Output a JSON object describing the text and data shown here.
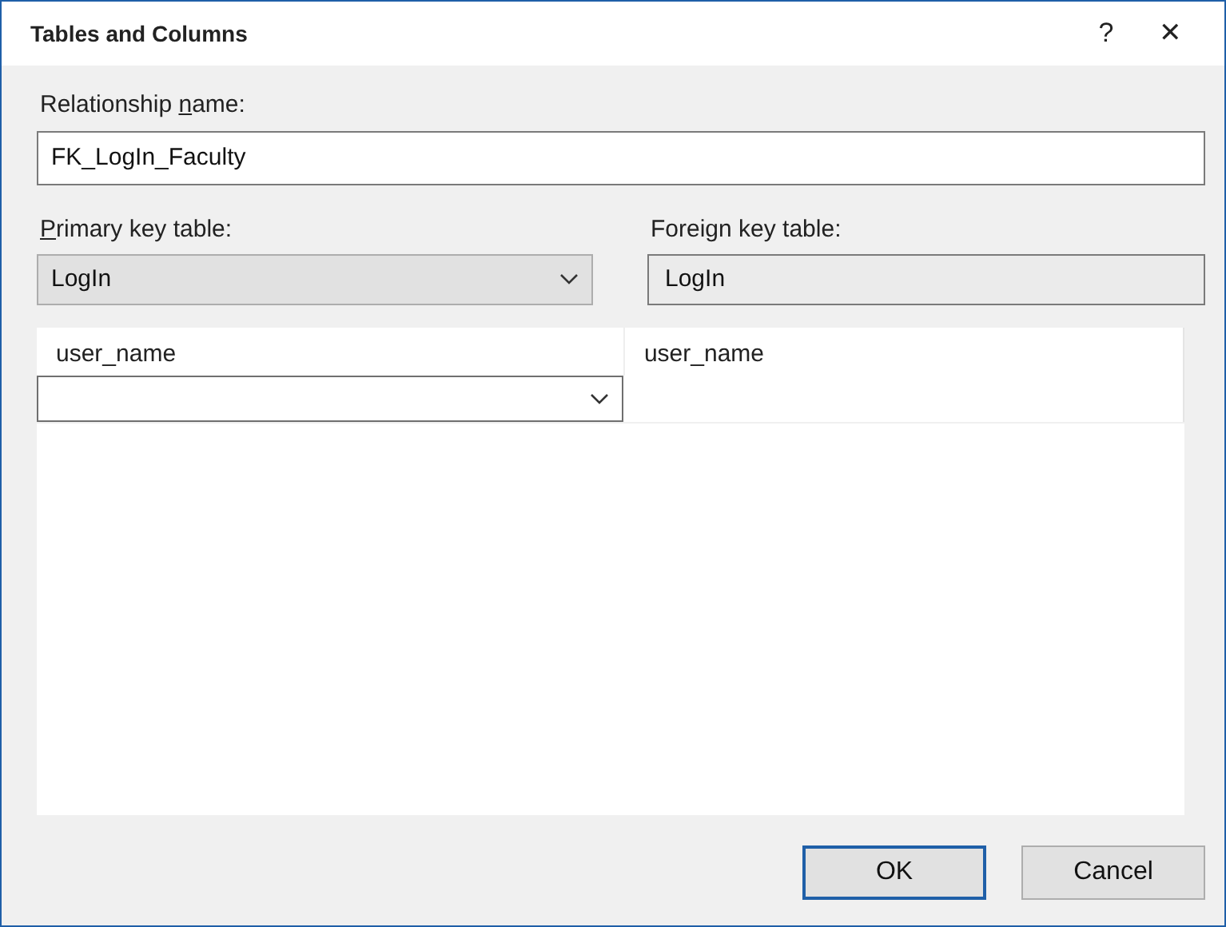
{
  "window": {
    "title": "Tables and Columns",
    "help": "?",
    "close": "✕"
  },
  "relationship": {
    "label": {
      "before": "Relationship ",
      "key": "n",
      "after": "ame:"
    },
    "value": "FK_LogIn_Faculty"
  },
  "primary": {
    "label": {
      "key": "P",
      "after": "rimary key table:"
    },
    "value": "LogIn"
  },
  "foreign": {
    "label": {
      "before": "Foreign key table:"
    },
    "value": "LogIn"
  },
  "grid": {
    "columns": [
      {
        "header": "user_name"
      },
      {
        "header": "user_name"
      }
    ],
    "rows": [
      {
        "kind": "combo"
      }
    ]
  },
  "buttons": [
    {
      "label": "OK",
      "default": true
    },
    {
      "label": "Cancel",
      "default": false
    }
  ]
}
